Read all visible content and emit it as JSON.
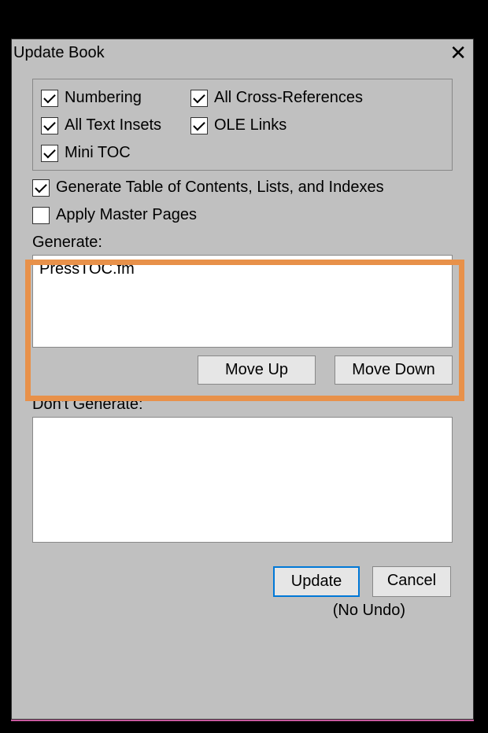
{
  "titlebar": {
    "title": "Update Book"
  },
  "checks": {
    "numbering": "Numbering",
    "allCrossRefs": "All Cross-References",
    "allTextInsets": "All Text Insets",
    "oleLinks": "OLE Links",
    "miniToc": "Mini TOC",
    "generateToc": "Generate Table of Contents, Lists, and Indexes",
    "applyMaster": "Apply Master Pages"
  },
  "labels": {
    "generate": "Generate:",
    "dontGenerate": "Don't Generate:"
  },
  "generateList": {
    "item0": "PressTOC.fm"
  },
  "buttons": {
    "moveUp": "Move Up",
    "moveDown": "Move Down",
    "update": "Update",
    "cancel": "Cancel"
  },
  "footer": {
    "noUndo": "(No Undo)"
  }
}
